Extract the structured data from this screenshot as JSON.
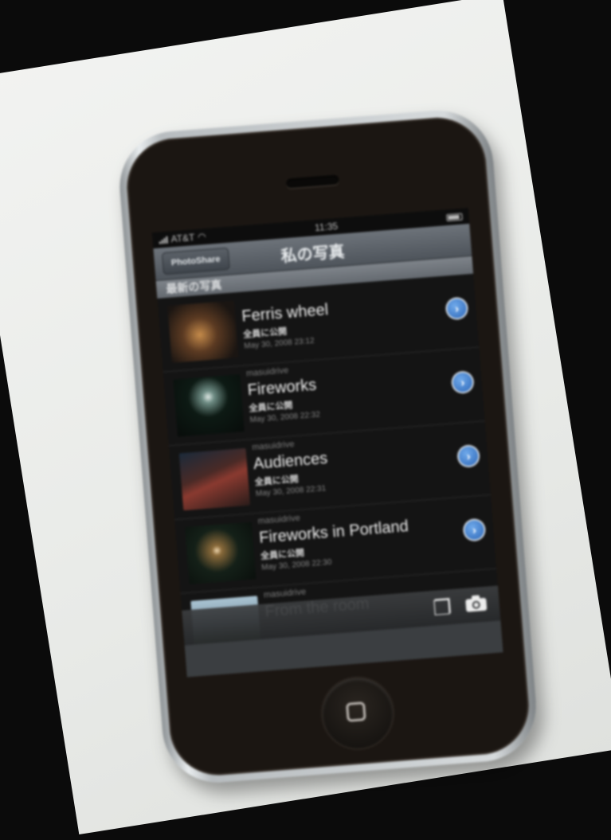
{
  "status_bar": {
    "carrier": "AT&T",
    "time": "11:35"
  },
  "nav_bar": {
    "back_label": "PhotoShare",
    "title": "私の写真"
  },
  "section": {
    "header": "最新の写真"
  },
  "photos": [
    {
      "author": "",
      "title": "Ferris wheel",
      "visibility": "全員に公開",
      "date": "May 30, 2008 23:12",
      "thumb_color": "#5b3a22"
    },
    {
      "author": "masuidrive",
      "title": "Fireworks",
      "visibility": "全員に公開",
      "date": "May 30, 2008 22:32",
      "thumb_color": "#0d1a14"
    },
    {
      "author": "masuidrive",
      "title": "Audiences",
      "visibility": "全員に公開",
      "date": "May 30, 2008 22:31",
      "thumb_color": "#2a1c1a"
    },
    {
      "author": "masuidrive",
      "title": "Fireworks in Portland",
      "visibility": "全員に公開",
      "date": "May 30, 2008 22:30",
      "thumb_color": "#142018"
    },
    {
      "author": "masuidrive",
      "title": "From the room",
      "visibility": "",
      "date": "",
      "thumb_color": "#7d96a6"
    }
  ],
  "toolbar": {
    "copy_icon": "copy-icon",
    "camera_icon": "camera-icon"
  },
  "colors": {
    "disclosure_blue": "#3a7bd5",
    "nav_bar": "#5e646b"
  }
}
